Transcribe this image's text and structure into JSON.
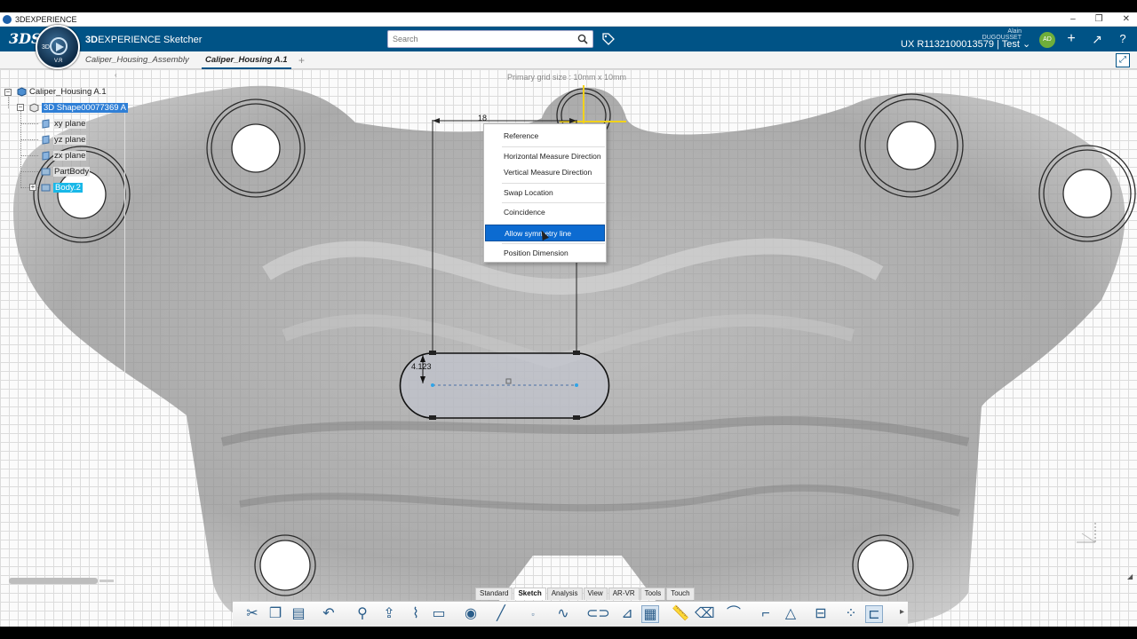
{
  "window": {
    "title": "3DEXPERIENCE",
    "minimize": "–",
    "restore": "❐",
    "close": "✕"
  },
  "header": {
    "brand": "3DS",
    "compass_3d": "3D",
    "compass_vr": "V.R",
    "app_name_bold": "3D",
    "app_name_rest": "EXPERIENCE Sketcher",
    "search_placeholder": "Search",
    "user_name": "Alain DUGOUSSET",
    "space": "UX R1132100013579 | Test",
    "avatar_initials": "AD"
  },
  "tabs": [
    {
      "label": "Caliper_Housing_Assembly",
      "active": false
    },
    {
      "label": "Caliper_Housing A.1",
      "active": true
    }
  ],
  "tab_add": "+",
  "viewport": {
    "grid_caption": "Primary grid size : 10mm x 10mm"
  },
  "tree": {
    "root": "Caliper_Housing A.1",
    "shape": "3D Shape00077369 A",
    "planes": [
      "xy plane",
      "yz plane",
      "zx plane"
    ],
    "partbody": "PartBody",
    "body": "Body.2"
  },
  "dimensions": {
    "horizontal": "18",
    "vertical": "4.123"
  },
  "context_menu": {
    "items": [
      {
        "label": "Reference",
        "highlighted": false
      },
      {
        "label": "Horizontal Measure Direction",
        "highlighted": false
      },
      {
        "label": "Vertical Measure Direction",
        "highlighted": false
      },
      {
        "label": "Swap Location",
        "highlighted": false
      },
      {
        "label": "Coincidence",
        "highlighted": false
      },
      {
        "label": "Allow symmetry line",
        "highlighted": true
      },
      {
        "label": "Position Dimension",
        "highlighted": false
      }
    ]
  },
  "bottom_tabs": [
    {
      "label": "Standard",
      "active": false
    },
    {
      "label": "Sketch",
      "active": true
    },
    {
      "label": "Analysis",
      "active": false
    },
    {
      "label": "View",
      "active": false
    },
    {
      "label": "AR-VR",
      "active": false
    },
    {
      "label": "Tools",
      "active": false
    },
    {
      "label": "Touch",
      "active": false
    }
  ],
  "colors": {
    "header": "#005386",
    "highlight": "#0c6bd1",
    "tree_select": "#2f7fd6"
  }
}
